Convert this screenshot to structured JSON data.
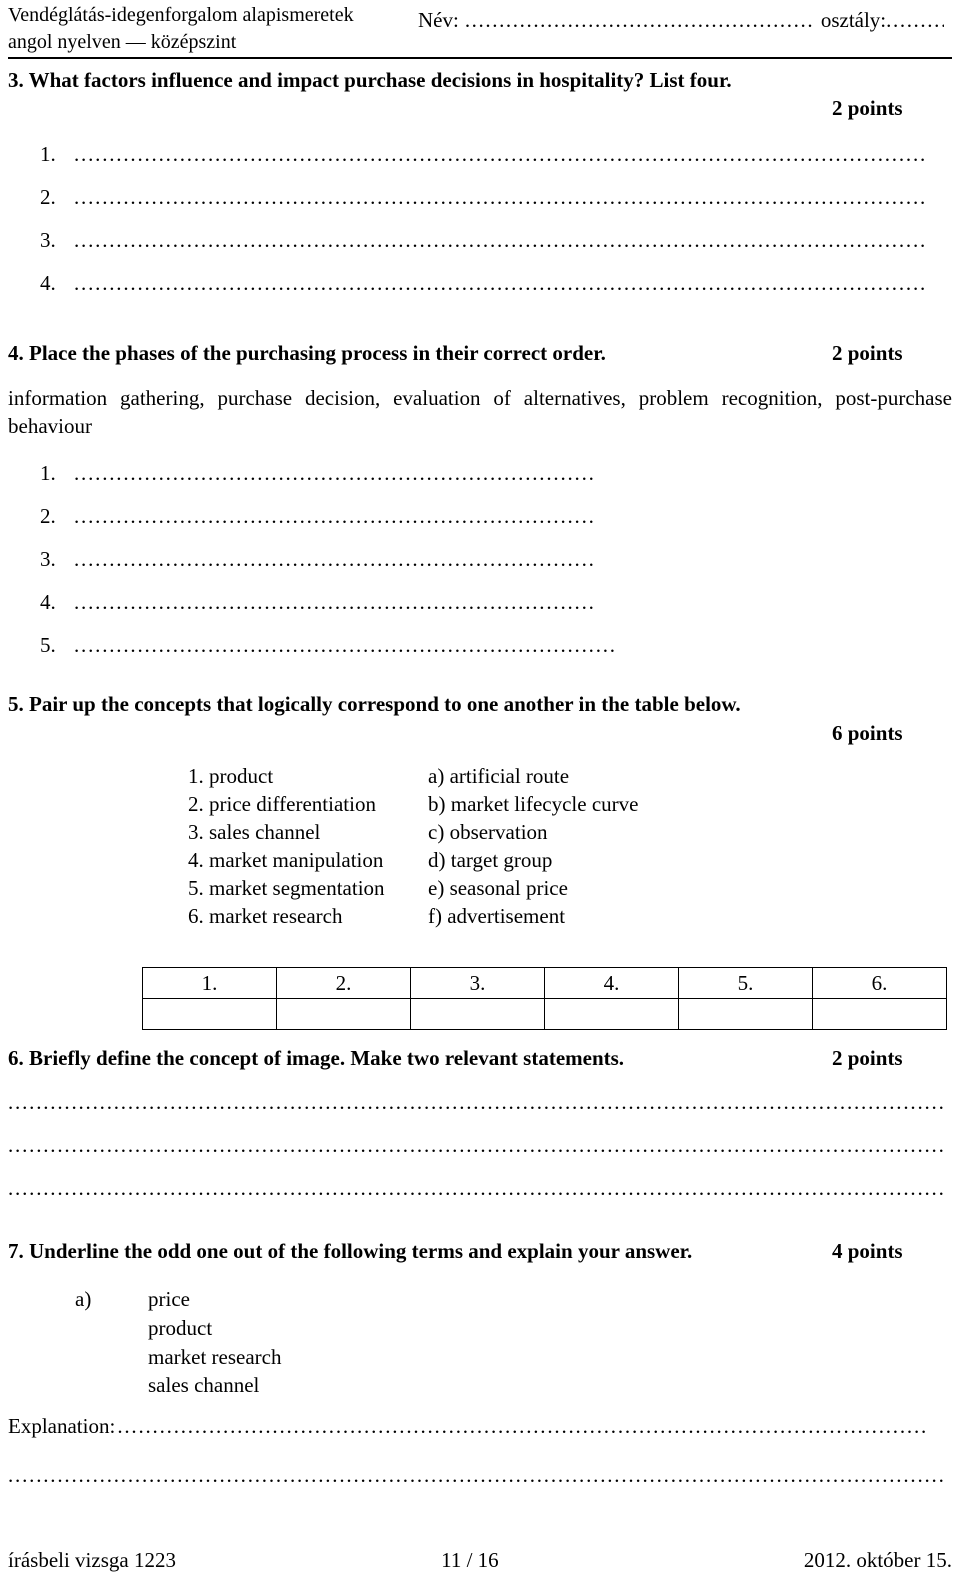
{
  "header": {
    "subject_line1": "Vendéglátás-idegenforgalom alapismeretek",
    "subject_line2": "angol nyelven — középszint",
    "name_label": "Név:",
    "name_dots": "..................................................................................................",
    "class_label": "osztály:",
    "class_dots": "........................"
  },
  "dots": {
    "long": "..........................................................................................................................................................................................................................................................................................................................",
    "medium": "....................................................................................................................................................................."
  },
  "q3": {
    "title": "3. What factors influence and impact purchase decisions in hospitality? List four.",
    "points": "2 points",
    "items": [
      "1.",
      "2.",
      "3.",
      "4."
    ]
  },
  "q4": {
    "title": "4. Place the phases of the purchasing process in their correct order.",
    "points": "2 points",
    "body": "information gathering, purchase decision, evaluation of alternatives, problem recognition, post-purchase behaviour",
    "items": [
      "1.",
      "2.",
      "3.",
      "4.",
      "5."
    ]
  },
  "q5": {
    "title": "5. Pair up the concepts that logically correspond to one another in the table below.",
    "points": "6 points",
    "left_column": [
      "1. product",
      "2. price differentiation",
      "3. sales channel",
      "4. market manipulation",
      "5. market segmentation",
      "6. market research"
    ],
    "right_column": [
      "a) artificial route",
      "b) market lifecycle curve",
      "c) observation",
      "d) target group",
      "e) seasonal price",
      "f) advertisement"
    ],
    "table_headers": [
      "1.",
      "2.",
      "3.",
      "4.",
      "5.",
      "6."
    ],
    "table_answers": [
      "",
      "",
      "",
      "",
      "",
      ""
    ]
  },
  "q6": {
    "title": "6. Briefly define the concept of image. Make two relevant statements.",
    "points": "2 points",
    "line_count": 3
  },
  "q7": {
    "title": "7. Underline the odd one out of the following terms and explain your answer.",
    "points": "4 points",
    "letter": "a)",
    "terms": [
      "price",
      "product",
      "market research",
      "sales channel"
    ],
    "explanation_label": "Explanation:",
    "explanation_dots": "...................................................................................................................................."
  },
  "footer": {
    "left": "írásbeli vizsga 1223",
    "center": "11 / 16",
    "right": "2012. október 15."
  }
}
